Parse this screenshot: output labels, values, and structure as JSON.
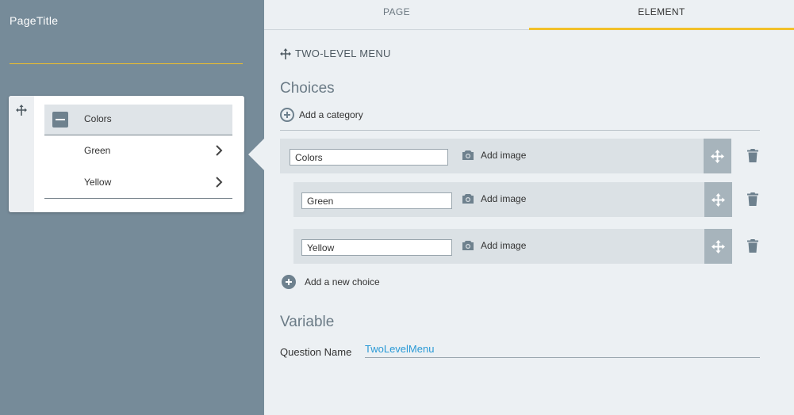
{
  "left_panel": {
    "page_title": "PageTitle",
    "menu": {
      "header_label": "Colors",
      "items": [
        {
          "label": "Green"
        },
        {
          "label": "Yellow"
        }
      ]
    }
  },
  "tabs": {
    "page": "PAGE",
    "element": "ELEMENT",
    "active": "ELEMENT"
  },
  "element": {
    "type_label": "TWO-LEVEL MENU",
    "choices_title": "Choices",
    "add_category_label": "Add a category",
    "category": {
      "value": "Colors",
      "add_image_label": "Add image"
    },
    "choices": [
      {
        "value": "Green",
        "add_image_label": "Add image"
      },
      {
        "value": "Yellow",
        "add_image_label": "Add image"
      }
    ],
    "add_choice_label": "Add a new choice",
    "variable_title": "Variable",
    "question_name_label": "Question Name",
    "question_name_value": "TwoLevelMenu"
  },
  "icons": {
    "move": "move-arrows-icon",
    "camera": "camera-icon",
    "trash": "trash-icon",
    "add": "plus-circle-icon",
    "collapse": "minus-square-icon",
    "chevron": "chevron-right-icon"
  },
  "colors": {
    "accent": "#f2c029",
    "left_panel_bg": "#768b99",
    "link_blue": "#2a9ad6"
  }
}
